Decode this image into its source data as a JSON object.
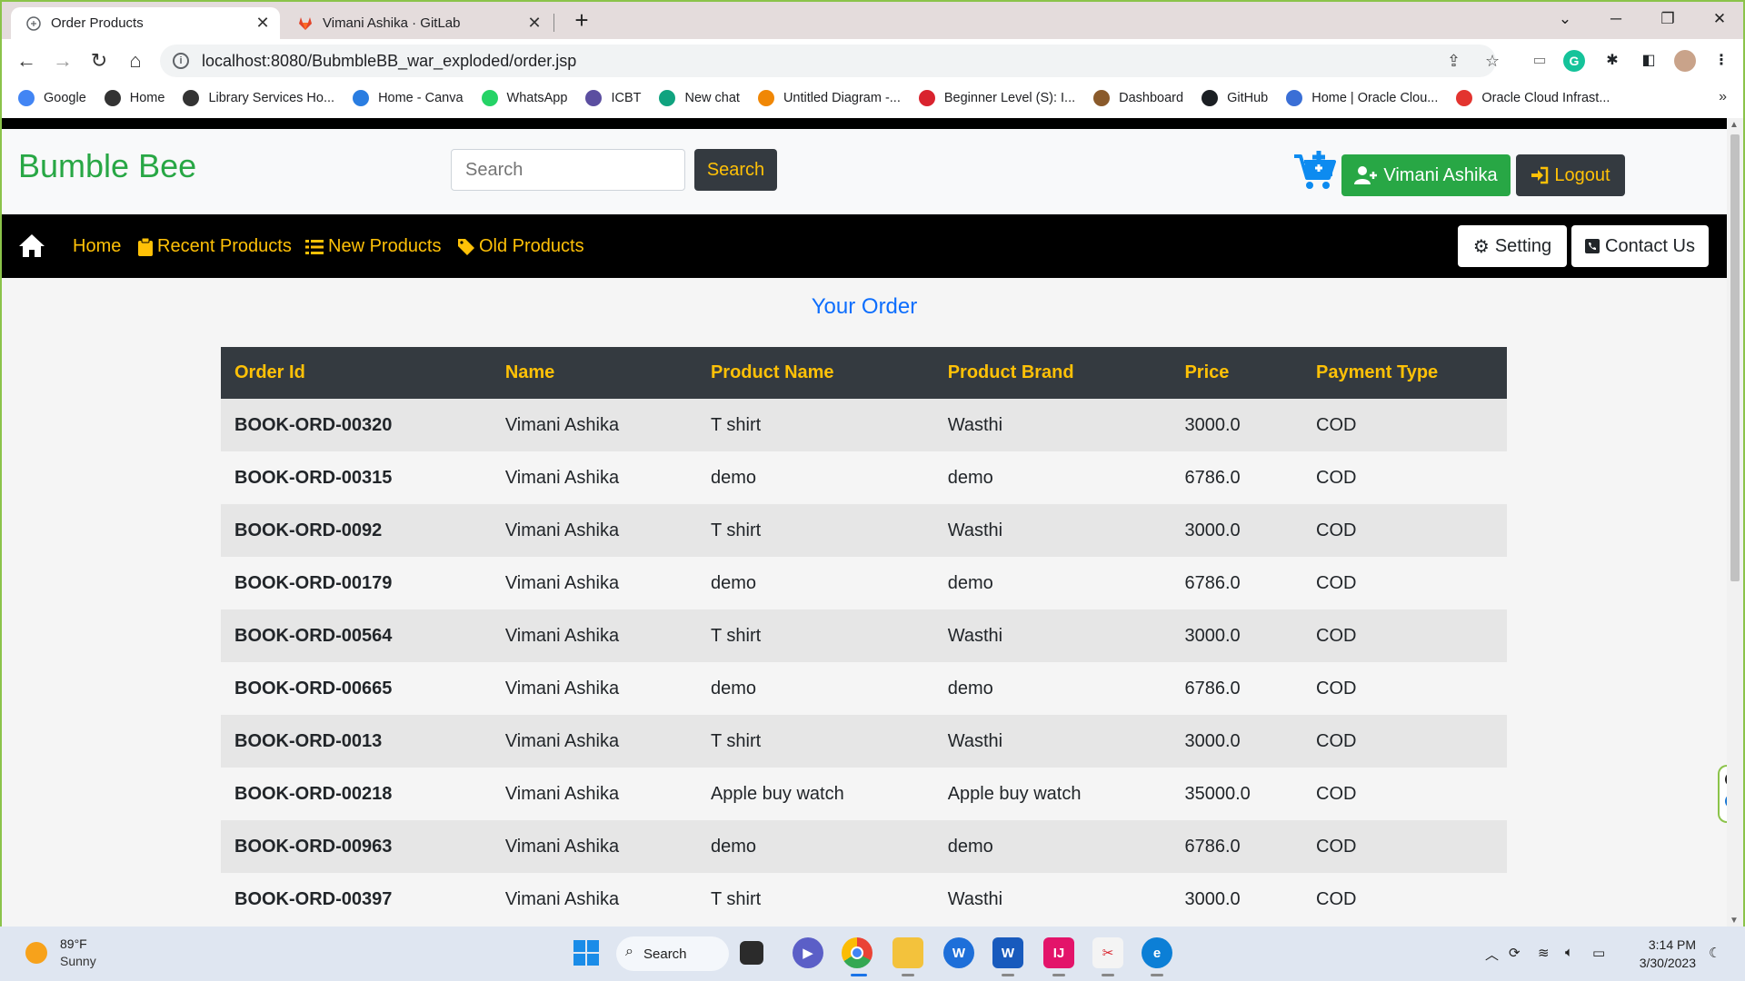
{
  "browser": {
    "tabs": [
      {
        "title": "Order Products",
        "active": true
      },
      {
        "title": "Vimani Ashika · GitLab",
        "active": false
      }
    ],
    "url": "localhost:8080/BubmbleBB_war_exploded/order.jsp",
    "bookmarks": [
      {
        "label": "Google",
        "icon": "google-icon",
        "color": "#4285f4"
      },
      {
        "label": "Home",
        "icon": "globe-icon",
        "color": "#333333"
      },
      {
        "label": "Library Services Ho...",
        "icon": "globe-icon",
        "color": "#333333"
      },
      {
        "label": "Home - Canva",
        "icon": "canva-icon",
        "color": "#2a7de1"
      },
      {
        "label": "WhatsApp",
        "icon": "whatsapp-icon",
        "color": "#25d366"
      },
      {
        "label": "ICBT",
        "icon": "icbt-icon",
        "color": "#5b4ea0"
      },
      {
        "label": "New chat",
        "icon": "chatgpt-icon",
        "color": "#10a37f"
      },
      {
        "label": "Untitled Diagram -...",
        "icon": "drawio-icon",
        "color": "#f08705"
      },
      {
        "label": "Beginner Level (S): I...",
        "icon": "pdf-icon",
        "color": "#d9232e"
      },
      {
        "label": "Dashboard",
        "icon": "dashboard-icon",
        "color": "#8a5a2b"
      },
      {
        "label": "GitHub",
        "icon": "github-icon",
        "color": "#1b1f23"
      },
      {
        "label": "Home | Oracle Clou...",
        "icon": "cloud-icon",
        "color": "#3a6fd6"
      },
      {
        "label": "Oracle Cloud Infrast...",
        "icon": "oracle-icon",
        "color": "#e3342f"
      }
    ]
  },
  "header": {
    "brand": "Bumble Bee",
    "search_placeholder": "Search",
    "search_button": "Search",
    "user_button": "Vimani Ashika",
    "logout_button": "Logout"
  },
  "nav": {
    "links": [
      {
        "label": "Home",
        "icon": "none"
      },
      {
        "label": "Recent Products",
        "icon": "clipboard-icon"
      },
      {
        "label": "New Products",
        "icon": "list-icon"
      },
      {
        "label": "Old Products",
        "icon": "tag-icon"
      }
    ],
    "setting_button": "Setting",
    "contact_button": "Contact Us"
  },
  "page": {
    "title": "Your Order",
    "columns": [
      "Order Id",
      "Name",
      "Product Name",
      "Product Brand",
      "Price",
      "Payment Type"
    ],
    "rows": [
      [
        "BOOK-ORD-00320",
        "Vimani Ashika",
        "T shirt",
        "Wasthi",
        "3000.0",
        "COD"
      ],
      [
        "BOOK-ORD-00315",
        "Vimani Ashika",
        "demo",
        "demo",
        "6786.0",
        "COD"
      ],
      [
        "BOOK-ORD-0092",
        "Vimani Ashika",
        "T shirt",
        "Wasthi",
        "3000.0",
        "COD"
      ],
      [
        "BOOK-ORD-00179",
        "Vimani Ashika",
        "demo",
        "demo",
        "6786.0",
        "COD"
      ],
      [
        "BOOK-ORD-00564",
        "Vimani Ashika",
        "T shirt",
        "Wasthi",
        "3000.0",
        "COD"
      ],
      [
        "BOOK-ORD-00665",
        "Vimani Ashika",
        "demo",
        "demo",
        "6786.0",
        "COD"
      ],
      [
        "BOOK-ORD-0013",
        "Vimani Ashika",
        "T shirt",
        "Wasthi",
        "3000.0",
        "COD"
      ],
      [
        "BOOK-ORD-00218",
        "Vimani Ashika",
        "Apple buy watch",
        "Apple buy watch",
        "35000.0",
        "COD"
      ],
      [
        "BOOK-ORD-00963",
        "Vimani Ashika",
        "demo",
        "demo",
        "6786.0",
        "COD"
      ],
      [
        "BOOK-ORD-00397",
        "Vimani Ashika",
        "T shirt",
        "Wasthi",
        "3000.0",
        "COD"
      ]
    ]
  },
  "taskbar": {
    "temperature": "89°F",
    "condition": "Sunny",
    "search_label": "Search",
    "time": "3:14 PM",
    "date": "3/30/2023"
  },
  "colors": {
    "brand_green": "#28a745",
    "accent_yellow": "#ffc107",
    "dark": "#343a40",
    "title_blue": "#0d6efd"
  }
}
